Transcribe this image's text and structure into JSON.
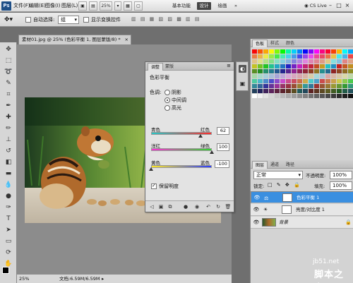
{
  "app": {
    "logo": "Ps",
    "menu": [
      "文件(F)",
      "编辑(E)",
      "图像(I)",
      "图层(L)",
      "选择(S)",
      "滤镜(T)",
      "分析(A)",
      "3D(D)",
      "视图(V)",
      "窗口(W)",
      "帮助(H)"
    ],
    "zoom_btn": "25%",
    "workspaces": [
      "基本功能",
      "设计",
      "绘画",
      "»"
    ],
    "cs_live": "CS Live"
  },
  "options": {
    "auto_select_label": "自动选择:",
    "auto_select_value": "组",
    "show_transform_label": "显示变换控件"
  },
  "document": {
    "tab_title": "素材01.jpg @ 25% (色彩平衡 1, 图层蒙版/8) *",
    "tab_close": "×",
    "status_zoom": "25%",
    "status_doc": "文档:6.59M/6.59M"
  },
  "adjustments": {
    "tabs": [
      "调整",
      "蒙版"
    ],
    "title": "色彩平衡",
    "tone_label": "色调:",
    "tones": [
      "阴影",
      "中间调",
      "高光"
    ],
    "selected_tone": "中间调",
    "sliders": [
      {
        "left": "青色",
        "right": "红色",
        "value": "62",
        "position": 0.81
      },
      {
        "left": "洋红",
        "right": "绿色",
        "value": "100",
        "position": 1.0
      },
      {
        "left": "黄色",
        "right": "蓝色",
        "value": "-100",
        "position": 0.0
      }
    ],
    "preserve_label": "保留明度",
    "preserve_checked": true
  },
  "swatches": {
    "tabs": [
      "色板",
      "样式",
      "颜色"
    ]
  },
  "layers": {
    "tabs": [
      "图层",
      "通道",
      "路径"
    ],
    "blend_mode": "正常",
    "opacity_label": "不透明度:",
    "opacity_value": "100%",
    "lock_label": "锁定:",
    "fill_label": "填充:",
    "fill_value": "100%",
    "rows": [
      {
        "name": "色彩平衡 1",
        "selected": true
      },
      {
        "name": "亮度/对比度 1",
        "selected": false
      },
      {
        "name": "背景",
        "selected": false
      }
    ]
  },
  "watermark": {
    "site": "jb51.net",
    "name": "脚本之家"
  },
  "colors": {
    "accent": "#3a8fe0",
    "panel_bg": "#e3e3e3",
    "app_bg": "#6f6f6f"
  }
}
